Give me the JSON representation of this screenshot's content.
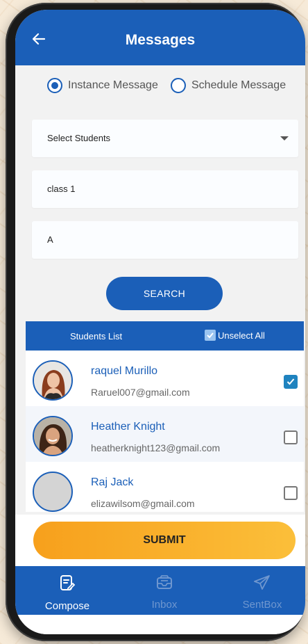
{
  "header": {
    "title": "Messages"
  },
  "message_type": {
    "options": [
      {
        "label": "Instance Message",
        "selected": true
      },
      {
        "label": "Schedule Message",
        "selected": false
      }
    ]
  },
  "form": {
    "students_select": "Select Students",
    "class_value": "class 1",
    "section_value": "A",
    "search_label": "SEARCH"
  },
  "students_list": {
    "title": "Students List",
    "unselect_all": "Unselect All",
    "students": [
      {
        "name": "raquel Murillo",
        "email": "Raruel007@gmail.com",
        "checked": true
      },
      {
        "name": "Heather Knight",
        "email": "heatherknight123@gmail.com",
        "checked": false
      },
      {
        "name": "Raj Jack",
        "email": "elizawilsom@gmail.com",
        "checked": false
      }
    ]
  },
  "submit_label": "SUBMIT",
  "bottom_nav": {
    "items": [
      {
        "label": "Compose",
        "icon": "compose-icon",
        "active": true
      },
      {
        "label": "Inbox",
        "icon": "inbox-icon",
        "active": false
      },
      {
        "label": "SentBox",
        "icon": "send-icon",
        "active": false
      }
    ]
  },
  "colors": {
    "primary": "#1b5fb8",
    "accent": "#f7a01c",
    "checkbox_checked": "#1f83bf"
  }
}
